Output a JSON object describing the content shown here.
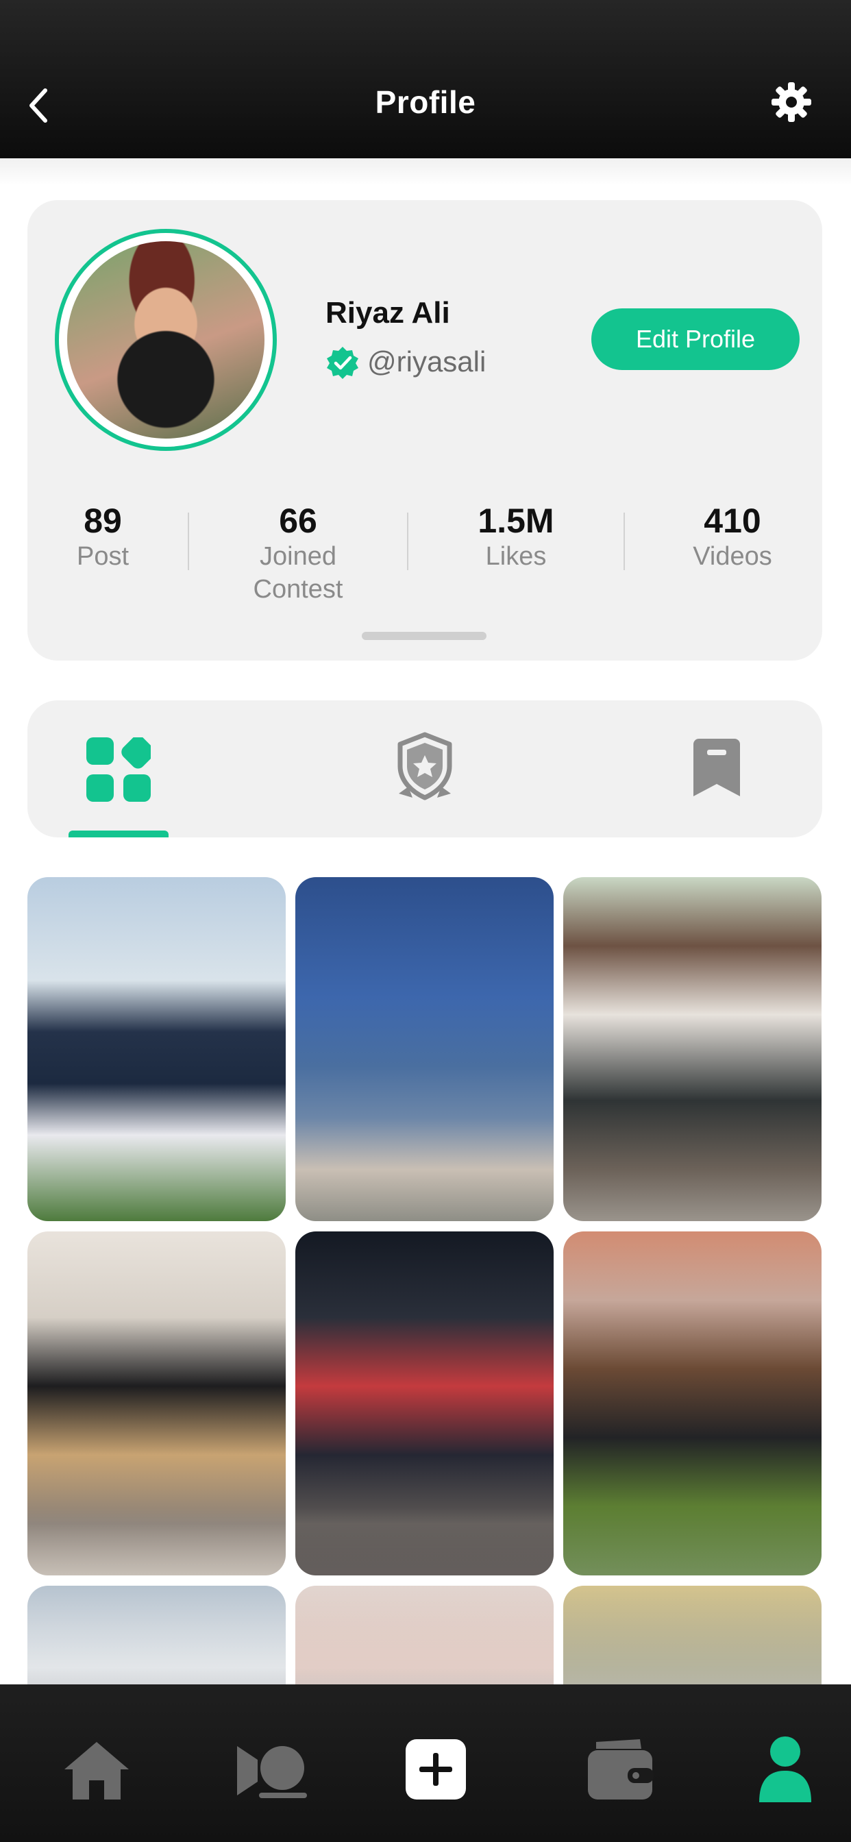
{
  "header": {
    "title": "Profile",
    "back_icon": "chevron-left-icon",
    "settings_icon": "gear-icon"
  },
  "profile": {
    "name": "Riyaz Ali",
    "handle": "@riyasali",
    "verified_icon": "verified-badge-icon",
    "edit_button_label": "Edit Profile",
    "stats": [
      {
        "value": "89",
        "label": "Post"
      },
      {
        "value": "66",
        "label": "Joined Contest"
      },
      {
        "value": "1.5M",
        "label": "Likes"
      },
      {
        "value": "410",
        "label": "Videos"
      }
    ]
  },
  "tabs": [
    {
      "icon": "grid-icon",
      "active": true
    },
    {
      "icon": "award-shield-icon",
      "active": false
    },
    {
      "icon": "bookmark-icon",
      "active": false
    }
  ],
  "grid": {
    "items": [
      {
        "alt": "photo-1"
      },
      {
        "alt": "photo-2"
      },
      {
        "alt": "photo-3"
      },
      {
        "alt": "photo-4"
      },
      {
        "alt": "photo-5"
      },
      {
        "alt": "photo-6"
      },
      {
        "alt": "photo-7"
      },
      {
        "alt": "photo-8"
      },
      {
        "alt": "photo-9"
      }
    ]
  },
  "bottom_nav": [
    {
      "icon": "home-icon",
      "active": false
    },
    {
      "icon": "video-contest-icon",
      "active": false
    },
    {
      "icon": "add-icon",
      "active": false
    },
    {
      "icon": "wallet-icon",
      "active": false
    },
    {
      "icon": "profile-icon",
      "active": true
    }
  ],
  "colors": {
    "accent": "#13c48f",
    "header_bg": "#111111",
    "card_bg": "#f1f1f1",
    "muted_text": "#8a8a8a",
    "nav_inactive": "#6a6a6a"
  }
}
